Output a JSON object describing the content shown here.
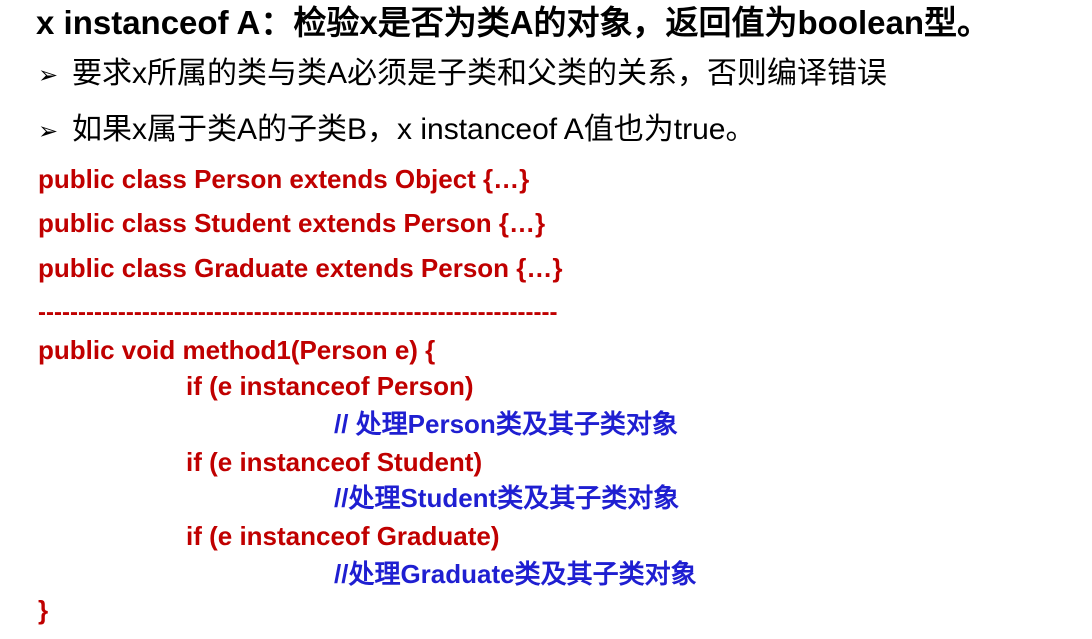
{
  "title": {
    "code": "x instanceof A",
    "text": "：检验x是否为类A的对象，返回值为boolean型。"
  },
  "bullets": [
    "要求x所属的类与类A必须是子类和父类的关系，否则编译错误",
    "如果x属于类A的子类B，x instanceof  A值也为true。"
  ],
  "code_lines": {
    "class_person": "public class Person extends Object {…}",
    "class_student": "public class Student extends Person {…}",
    "class_graduate": "public class Graduate extends Person {…}",
    "separator": "-----------------------------------------------------------------",
    "method_sig": "public void method1(Person e) {",
    "if_person": "if (e instanceof Person)",
    "comment_person": "// 处理Person类及其子类对象",
    "if_student": "if (e instanceof Student)",
    "comment_student": "//处理Student类及其子类对象",
    "if_graduate": "if (e instanceof Graduate)",
    "comment_graduate": "//处理Graduate类及其子类对象",
    "close_brace": "}"
  },
  "colors": {
    "code": "#c00000",
    "comment": "#1f1fd1",
    "text": "#000000"
  },
  "icons": {
    "bullet": "arrow-bullet-icon"
  }
}
